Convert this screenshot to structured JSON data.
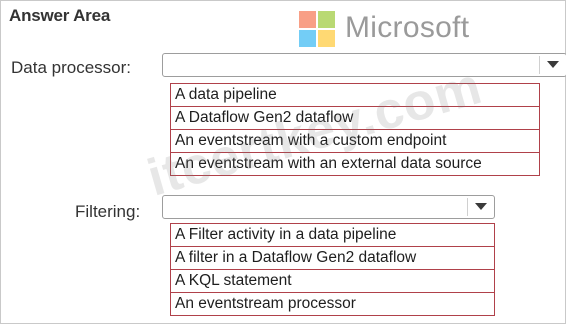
{
  "answer_area": {
    "title": "Answer Area"
  },
  "brand": {
    "name": "Microsoft"
  },
  "watermark": {
    "text": "itcertkey.com"
  },
  "data_processor": {
    "label": "Data processor:",
    "selected": "",
    "options": [
      "A data pipeline",
      "A Dataflow Gen2 dataflow",
      "An eventstream with a custom endpoint",
      "An eventstream with an external data source"
    ]
  },
  "filtering": {
    "label": "Filtering:",
    "selected": "",
    "options": [
      "A Filter activity in a data pipeline",
      "A filter in a Dataflow Gen2 dataflow",
      "A KQL statement",
      "An eventstream processor"
    ]
  },
  "colors": {
    "option_border": "#b0414a",
    "logo_red": "#f25022",
    "logo_green": "#7fba00",
    "logo_blue": "#00a4ef",
    "logo_yellow": "#ffb900"
  },
  "icons": {
    "dropdown": "chevron-down-icon",
    "logo": "microsoft-logo-icon"
  }
}
